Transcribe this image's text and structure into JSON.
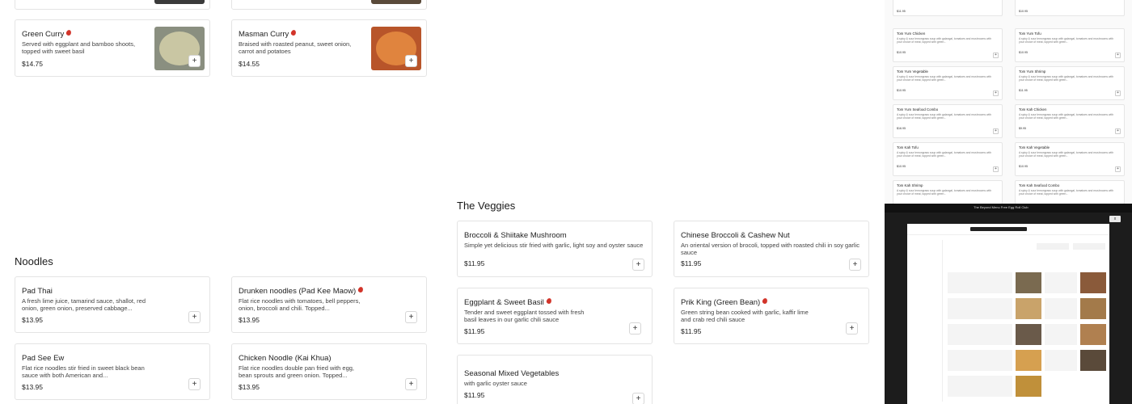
{
  "colors": {
    "chili": "#d2342a",
    "border": "#e4e4e4",
    "banner": "#111111"
  },
  "top_partial": {
    "items": [
      "",
      ""
    ]
  },
  "curries": [
    {
      "name": "Green Curry",
      "desc": "Served with eggplant and bamboo shoots, topped with sweet basil",
      "price": "$14.75",
      "image": "green-curry-photo"
    },
    {
      "name": "Masman Curry",
      "desc": "Braised with roasted peanut, sweet onion, carrot and potatoes",
      "price": "$14.55",
      "image": "masman-curry-photo"
    }
  ],
  "noodles": {
    "title": "Noodles",
    "items": [
      {
        "name": "Pad Thai",
        "desc": "A fresh lime juice, tamarind sauce, shallot, red onion, green onion, preserved cabbage...",
        "price": "$13.95"
      },
      {
        "name": "Drunken noodles (Pad Kee Maow)",
        "desc": "Flat rice noodles with tomatoes, bell peppers, onion, broccoli and chili. Topped...",
        "price": "$13.95",
        "spicy": true
      },
      {
        "name": "Pad See Ew",
        "desc": "Flat rice noodles stir fried in sweet black bean sauce with both American and...",
        "price": "$13.95"
      },
      {
        "name": "Chicken Noodle (Kai Khua)",
        "desc": "Flat rice noodles double pan fried with egg, bean sprouts and green onion. Topped...",
        "price": "$13.95"
      }
    ]
  },
  "veggies": {
    "title": "The Veggies",
    "items": [
      {
        "name": "Broccoli & Shiitake Mushroom",
        "desc": "Simple yet delicious stir fried with garlic, light soy and oyster sauce",
        "price": "$11.95"
      },
      {
        "name": "Chinese Broccoli & Cashew Nut",
        "desc": "An oriental version of brocoli, topped with roasted chili in soy garlic sauce",
        "price": "$11.95"
      },
      {
        "name": "Eggplant & Sweet Basil",
        "desc": "Tender and sweet eggplant tossed with fresh basil leaves in our garlic chili sauce",
        "price": "$11.95",
        "spicy": true
      },
      {
        "name": "Prik King (Green Bean)",
        "desc": "Green string bean cooked with garlic, kaffir lime and crab red chili sauce",
        "price": "$11.95",
        "spicy": true
      },
      {
        "name": "Seasonal Mixed Vegetables",
        "desc": "with garlic oyster sauce",
        "price": "$11.95"
      }
    ]
  },
  "add_label": "+",
  "mini_menu": {
    "items": [
      {
        "name": "Tom Yum Chicken",
        "price": "$10.95"
      },
      {
        "name": "Tom Yum Tofu",
        "price": "$10.95"
      },
      {
        "name": "Tom Yum Vegetable",
        "price": "$10.95"
      },
      {
        "name": "Tom Yum Shrimp",
        "price": "$11.95"
      },
      {
        "name": "Tom Yum Seafood Combo",
        "price": "$16.95"
      },
      {
        "name": "Tom Kah Chicken",
        "price": "$9.95"
      },
      {
        "name": "Tom Kah Tofu",
        "price": "$10.95"
      },
      {
        "name": "Tom Kah Vegetable",
        "price": "$10.95"
      },
      {
        "name": "Tom Kah Shrimp",
        "price": ""
      },
      {
        "name": "Tom Kah Seafood Combo",
        "price": ""
      }
    ],
    "desc": "A spicy & sour lemongrass soup with galangal, tomatoes and mushrooms with your choice of meat, topped with green..."
  },
  "banner_text": "The Beyond Menu Free Egg Roll Club",
  "shot": {
    "close": "x"
  }
}
